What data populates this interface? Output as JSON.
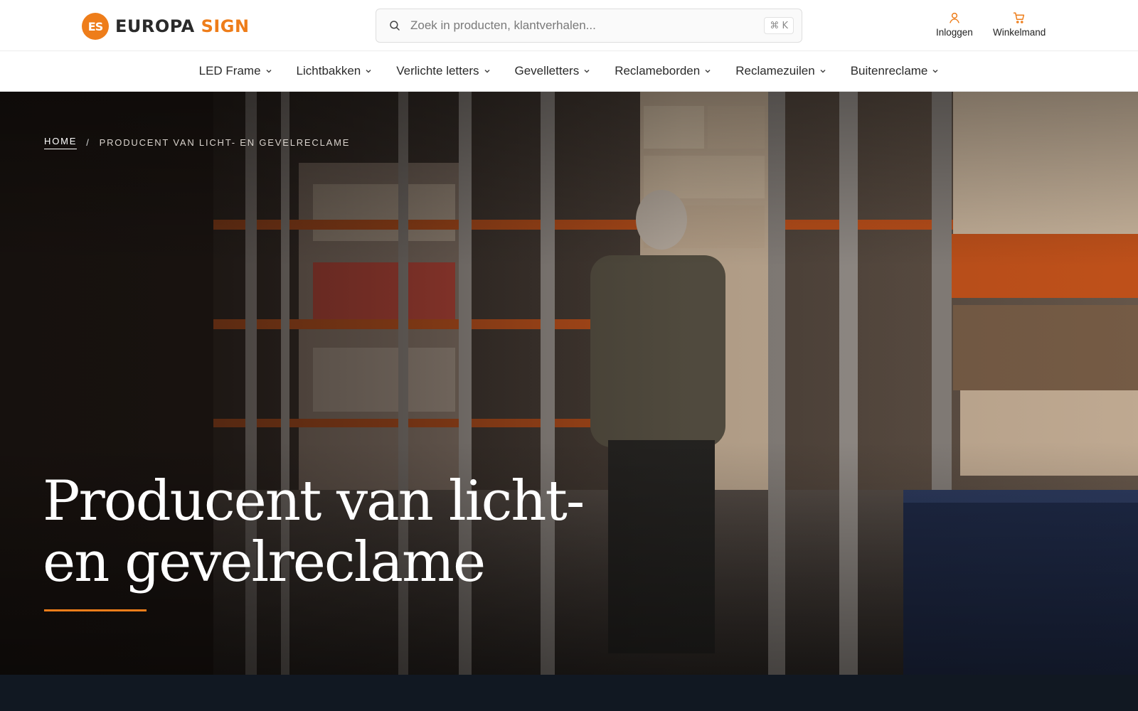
{
  "brand": {
    "logo_mark": "ES",
    "name_part1": "EUROPA",
    "name_part2": "SIGN"
  },
  "search": {
    "placeholder": "Zoek in producten, klantverhalen...",
    "shortcut": "⌘ K"
  },
  "account": {
    "login_label": "Inloggen",
    "cart_label": "Winkelmand"
  },
  "nav": {
    "items": [
      {
        "label": "LED Frame"
      },
      {
        "label": "Lichtbakken"
      },
      {
        "label": "Verlichte letters"
      },
      {
        "label": "Gevelletters"
      },
      {
        "label": "Reclameborden"
      },
      {
        "label": "Reclamezuilen"
      },
      {
        "label": "Buitenreclame"
      }
    ]
  },
  "breadcrumb": {
    "home": "HOME",
    "separator": "/",
    "current": "PRODUCENT VAN LICHT- EN GEVELRECLAME"
  },
  "hero": {
    "title_line1": "Producent van licht-",
    "title_line2": "en gevelreclame"
  },
  "colors": {
    "accent": "#ee7d1a",
    "footer_bg": "#111822",
    "text_dark": "#2b2b2b"
  }
}
